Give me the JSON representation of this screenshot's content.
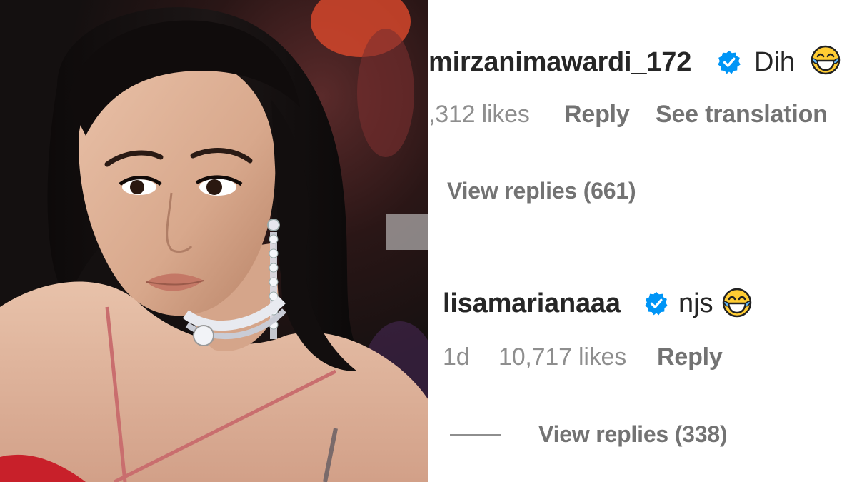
{
  "photo": {
    "description_icon": "portrait-photo"
  },
  "comments": [
    {
      "username": "mirzanimawardi_172",
      "verified": true,
      "text": "Dih",
      "emoji": "face-with-tears-of-joy",
      "likes": ",312 likes",
      "reply_label": "Reply",
      "translation_label": "See translation",
      "view_replies": "View replies (661)"
    },
    {
      "username": "lisamarianaaa",
      "verified": true,
      "text": "njs",
      "emoji": "face-with-tears-of-joy",
      "age": "1d",
      "likes": "10,717 likes",
      "reply_label": "Reply",
      "view_replies": "View replies (338)"
    }
  ],
  "colors": {
    "username": "#262626",
    "meta": "#737373",
    "verified_blue": "#0095f6"
  }
}
